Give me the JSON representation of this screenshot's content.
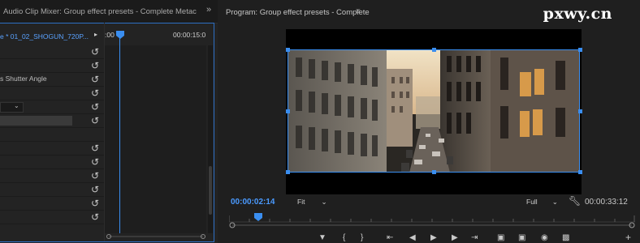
{
  "left_panel": {
    "tabs": {
      "audio_mixer": "Audio Clip Mixer: Group effect presets - Complete",
      "metadata": "Metac",
      "overflow": "»"
    },
    "sequence_clip": "e * 01_02_SHOGUN_720P...",
    "ruler_start": ":00",
    "ruler_end": "00:00:15:0",
    "rows": [
      {
        "label": ""
      },
      {
        "label": ""
      },
      {
        "label": "s Shutter Angle"
      },
      {
        "label": ""
      },
      {
        "label": ""
      },
      {
        "label": ""
      },
      {
        "label": ""
      },
      {
        "label": ""
      },
      {
        "label": ""
      },
      {
        "label": ""
      },
      {
        "label": ""
      },
      {
        "label": ""
      },
      {
        "label": ""
      }
    ]
  },
  "program": {
    "title": "Program: Group effect presets - Complete",
    "menu_icon": "hamburger-icon",
    "current_timecode": "00:00:02:14",
    "zoom_fit": "Fit",
    "quality": "Full",
    "duration": "00:00:33:12"
  },
  "watermark": "pxwy.cn",
  "colors": {
    "accent": "#3a8ef0",
    "timecode_blue": "#4a9aff"
  }
}
